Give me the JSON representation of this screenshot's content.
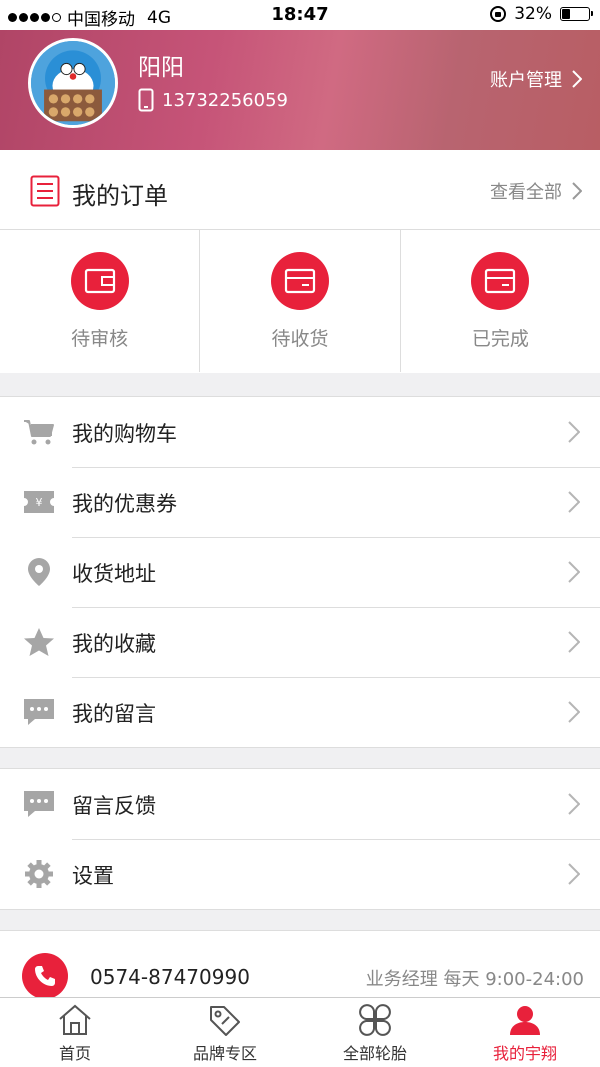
{
  "status_bar": {
    "carrier": "中国移动",
    "network": "4G",
    "time": "18:47",
    "battery": "32%",
    "battery_level": 0.32,
    "signal_bars": 4
  },
  "profile": {
    "name": "阳阳",
    "phone": "13732256059",
    "account_link": "账户管理"
  },
  "orders": {
    "title": "我的订单",
    "view_all": "查看全部",
    "states": [
      {
        "label": "待审核",
        "icon": "wallet-icon"
      },
      {
        "label": "待收货",
        "icon": "box-icon"
      },
      {
        "label": "已完成",
        "icon": "box-icon"
      }
    ]
  },
  "menu_main": [
    {
      "label": "我的购物车",
      "icon": "cart-icon"
    },
    {
      "label": "我的优惠券",
      "icon": "coupon-icon"
    },
    {
      "label": "收货地址",
      "icon": "location-pin-icon"
    },
    {
      "label": "我的收藏",
      "icon": "star-icon"
    },
    {
      "label": "我的留言",
      "icon": "message-icon"
    }
  ],
  "menu_secondary": [
    {
      "label": "留言反馈",
      "icon": "message-icon"
    },
    {
      "label": "设置",
      "icon": "gear-icon"
    }
  ],
  "contact": {
    "phone": "0574-87470990",
    "hours": "业务经理 每天 9:00-24:00"
  },
  "tabbar": {
    "tabs": [
      {
        "label": "首页",
        "icon": "home-icon",
        "active": false
      },
      {
        "label": "品牌专区",
        "icon": "tag-icon",
        "active": false
      },
      {
        "label": "全部轮胎",
        "icon": "grid-clover-icon",
        "active": false
      },
      {
        "label": "我的宇翔",
        "icon": "user-icon",
        "active": true
      }
    ]
  },
  "colors": {
    "accent": "#e8213b",
    "header_start": "#b04566",
    "header_end": "#b85e64",
    "icon_gray": "#9a9a9a"
  }
}
